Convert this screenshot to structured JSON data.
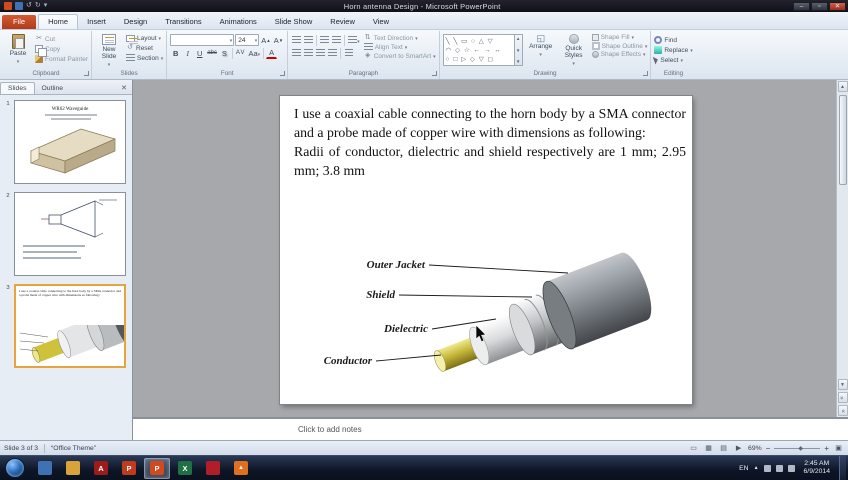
{
  "titlebar": {
    "title": "Horn antenna Design - Microsoft PowerPoint"
  },
  "window_controls": {
    "minimize": "–",
    "maximize": "▫",
    "close": "✕"
  },
  "colors": {
    "file_tab": "#b13a1c",
    "selection_border": "#e8a33d",
    "taskbar": "#0d1526",
    "powerpoint_orange": "#d2491e"
  },
  "ribbon": {
    "tabs": [
      {
        "label": "File"
      },
      {
        "label": "Home"
      },
      {
        "label": "Insert"
      },
      {
        "label": "Design"
      },
      {
        "label": "Transitions"
      },
      {
        "label": "Animations"
      },
      {
        "label": "Slide Show"
      },
      {
        "label": "Review"
      },
      {
        "label": "View"
      }
    ],
    "icons": {
      "scissors": "✂",
      "grow_font": "A",
      "shrink_font": "A"
    },
    "clipboard": {
      "label": "Clipboard",
      "paste": "Paste",
      "cut": "Cut",
      "copy": "Copy",
      "format_painter": "Format Painter"
    },
    "slides_group": {
      "label": "Slides",
      "new_slide": "New Slide",
      "layout": "Layout",
      "reset": "Reset",
      "section": "Section"
    },
    "font": {
      "label": "Font",
      "size_value": "24",
      "bold": "B",
      "italic": "I",
      "underline": "U",
      "strikethrough": "abc",
      "shadow": "S",
      "char_spacing": "AV",
      "change_case": "Aa",
      "font_color": "A"
    },
    "paragraph": {
      "label": "Paragraph",
      "text_direction": "Text Direction",
      "align_text": "Align Text",
      "convert_smartart": "Convert to SmartArt"
    },
    "drawing": {
      "label": "Drawing",
      "arrange": "Arrange",
      "quick_styles": "Quick Styles",
      "shape_fill": "Shape Fill",
      "shape_outline": "Shape Outline",
      "shape_effects": "Shape Effects",
      "shapes_rows": [
        "╲ ╲ ▭ ○ △ ▽",
        "◠ ◇ ☆ ← → ↔",
        "○ □ ▷ ◇ ▽ ◻"
      ]
    },
    "editing": {
      "label": "Editing",
      "find": "Find",
      "replace": "Replace",
      "select": "Select"
    }
  },
  "sidebar": {
    "tabs": [
      {
        "label": "Slides"
      },
      {
        "label": "Outline"
      }
    ],
    "close": "✕",
    "slides": [
      {
        "number": "1",
        "title": "WR62 Waveguide"
      },
      {
        "number": "2"
      },
      {
        "number": "3"
      }
    ]
  },
  "slide": {
    "paragraph1": "I use a coaxial cable connecting to the horn body by a SMA connector and a probe made of copper wire with dimensions as following:",
    "paragraph2": "Radii of conductor, dielectric and shield respectively are 1 mm; 2.95 mm; 3.8 mm",
    "labels": {
      "outer_jacket": "Outer Jacket",
      "shield": "Shield",
      "dielectric": "Dielectric",
      "conductor": "Conductor"
    }
  },
  "notes": {
    "placeholder": "Click to add notes"
  },
  "status": {
    "slide_indicator": "Slide 3 of 3",
    "theme": "“Office Theme”",
    "zoom": "69%"
  },
  "taskbar": {
    "apps": [
      {
        "name": "explorer",
        "glyph": "",
        "color": "#3f71b5"
      },
      {
        "name": "folder",
        "glyph": "",
        "color": "#d9a33c"
      },
      {
        "name": "adobe-reader",
        "glyph": "A",
        "color": "#9e1b1b"
      },
      {
        "name": "pdf",
        "glyph": "P",
        "color": "#c03a1e"
      },
      {
        "name": "powerpoint",
        "glyph": "P",
        "color": "#d2491e"
      },
      {
        "name": "excel",
        "glyph": "X",
        "color": "#1f7145"
      },
      {
        "name": "media-player",
        "glyph": "",
        "color": "#b01e28"
      },
      {
        "name": "vlc",
        "glyph": "▲",
        "color": "#e06f1f"
      }
    ],
    "tray": {
      "lang": "EN",
      "time": "2:45 AM",
      "date": "6/9/2014"
    }
  }
}
